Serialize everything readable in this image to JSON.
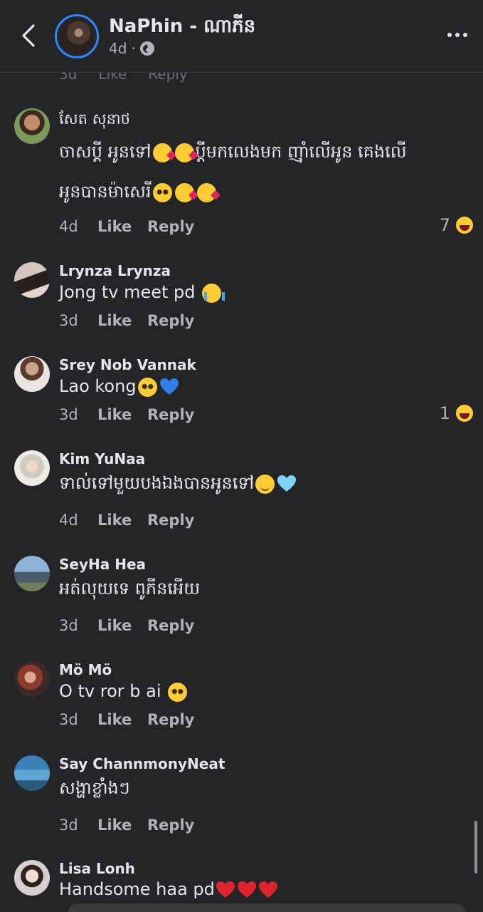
{
  "header": {
    "page_name": "NaPhin - ណាភីន",
    "post_time": "4d",
    "privacy_icon": "globe-icon",
    "back_icon": "chevron-left-icon",
    "more_icon": "more-horizontal-icon"
  },
  "partial_row": {
    "time": "3d",
    "like": "Like",
    "reply": "Reply"
  },
  "comments": [
    {
      "author": "សែត សុនាថ",
      "line1": "ចាសប្ដី អូនទៅ",
      "line1b": "ប្ដីមកលេងមក ញ៉ាំលើអូន គេងលើ",
      "line2": "អូនបានម៉ាសេរី",
      "time": "4d",
      "like": "Like",
      "reply": "Reply",
      "reaction_count": "7",
      "reaction_icon": "haha-reaction-icon"
    },
    {
      "author": "Lrynza Lrynza",
      "text": "Jong tv meet pd",
      "time": "3d",
      "like": "Like",
      "reply": "Reply"
    },
    {
      "author": "Srey Nob Vannak",
      "text": "Lao kong",
      "time": "3d",
      "like": "Like",
      "reply": "Reply",
      "reaction_count": "1",
      "reaction_icon": "haha-reaction-icon"
    },
    {
      "author": "Kim YuNaa",
      "text": "ទាល់ទៅមួយបងឯងបានអូនទៅ",
      "time": "4d",
      "like": "Like",
      "reply": "Reply"
    },
    {
      "author": "SeyHa Hea",
      "text": "អត់លុយទេ ពូភីនអើយ",
      "time": "3d",
      "like": "Like",
      "reply": "Reply"
    },
    {
      "author": "Mö Mö",
      "text": "O tv ror b ai",
      "time": "3d",
      "like": "Like",
      "reply": "Reply"
    },
    {
      "author": "Say ChannmonyNeat",
      "text": "សង្ហាខ្លាំងៗ",
      "time": "3d",
      "like": "Like",
      "reply": "Reply"
    },
    {
      "author": "Lisa Lonh",
      "text": "Handsome haa pd"
    }
  ],
  "colors": {
    "background": "#242527",
    "text": "#e4e6eb",
    "secondary": "#b0b3b8",
    "accent": "#2d88ff"
  }
}
